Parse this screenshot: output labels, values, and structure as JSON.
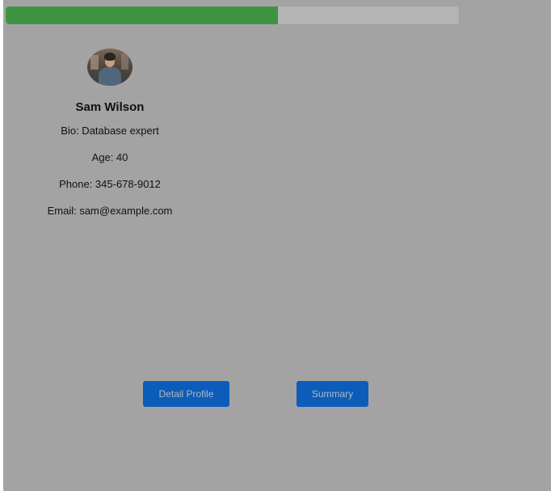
{
  "progress": {
    "value": 0.6,
    "fill_color": "#3f9444",
    "track_color": "#b4b4b4"
  },
  "profile": {
    "avatar_icon": "person-photo-icon",
    "name": "Sam Wilson",
    "bio": "Bio: Database expert",
    "age": "Age: 40",
    "phone": "Phone: 345-678-9012",
    "email": "Email: sam@example.com"
  },
  "buttons": {
    "detail_profile": "Detail Profile",
    "summary": "Summary"
  },
  "colors": {
    "overlay": "#a3a3a3",
    "button": "#0c5cba"
  }
}
